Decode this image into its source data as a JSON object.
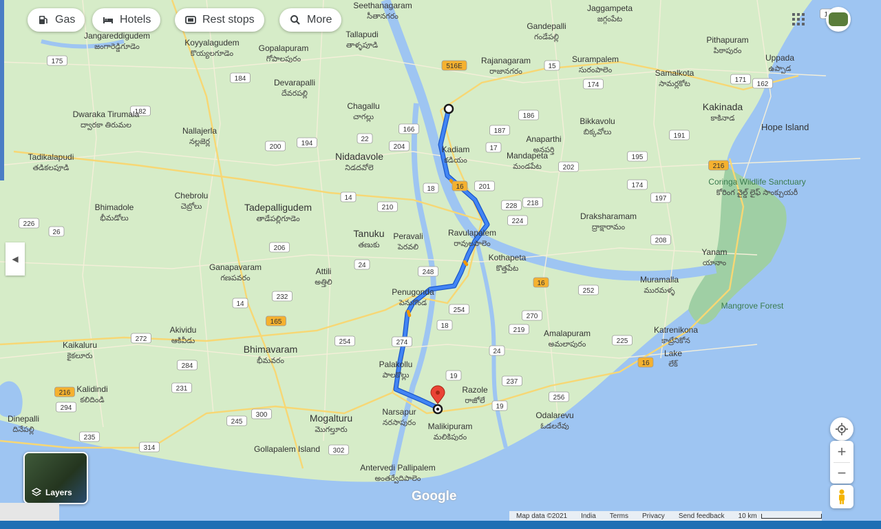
{
  "toolbar": {
    "gas": "Gas",
    "hotels": "Hotels",
    "rest_stops": "Rest stops",
    "more": "More"
  },
  "layers_label": "Layers",
  "footer": {
    "map_data": "Map data ©2021",
    "india": "India",
    "terms": "Terms",
    "privacy": "Privacy",
    "feedback": "Send feedback",
    "scale": "10 km"
  },
  "google_logo": "Google",
  "colors": {
    "land": "#d6ecc8",
    "water": "#9ec5f2",
    "route": "#4285f4",
    "route_outline": "#1a57c9",
    "highway_shield": "#f5b12f",
    "road": "#f7d774",
    "pin": "#ea4335"
  },
  "places": [
    {
      "name": "Seethanagaram",
      "native": "సీతానగరం"
    },
    {
      "name": "Jaggampeta",
      "native": "జగ్గంపేట"
    },
    {
      "name": "Gandepalli",
      "native": "గండేపల్లి"
    },
    {
      "name": "Pithapuram",
      "native": "పిఠాపురం"
    },
    {
      "name": "Tallapudi",
      "native": "తాళ్ళపూడి"
    },
    {
      "name": "Jangareddigudem",
      "native": "జంగారెడ్డిగూడెం"
    },
    {
      "name": "Koyyalagudem",
      "native": "కొయ్యలగూడెం"
    },
    {
      "name": "Gopalapuram",
      "native": "గోపాలపురం"
    },
    {
      "name": "Rajanagaram",
      "native": "రాజానగరం"
    },
    {
      "name": "Surampalem",
      "native": "సురంపాలెం"
    },
    {
      "name": "Samalkota",
      "native": "సామర్లకోట"
    },
    {
      "name": "Uppada",
      "native": "ఉప్పాడ"
    },
    {
      "name": "Devarapalli",
      "native": "దేవరపల్లి"
    },
    {
      "name": "Chagallu",
      "native": "చాగల్లు"
    },
    {
      "name": "Kakinada",
      "native": "కాకినాడ"
    },
    {
      "name": "Hope Island",
      "native": ""
    },
    {
      "name": "Dwaraka Tirumala",
      "native": "ద్వారకా తిరుమల"
    },
    {
      "name": "Nallajerla",
      "native": "నల్లజెర్ల"
    },
    {
      "name": "Bikkavolu",
      "native": "బిక్కవోలు"
    },
    {
      "name": "Anaparthi",
      "native": "అనపర్తి"
    },
    {
      "name": "Tadikalapudi",
      "native": "తడికలపూడి"
    },
    {
      "name": "Nidadavole",
      "native": "నిడదవోలె"
    },
    {
      "name": "Kadiam",
      "native": "కడియం"
    },
    {
      "name": "Mandapeta",
      "native": "మండపేట"
    },
    {
      "name": "Coringa Wildlife Sanctuary",
      "native": "కోరింగ వైల్డ్ లైఫ్ సాంక్చుయరీ"
    },
    {
      "name": "Chebrolu",
      "native": "చెబ్రోలు"
    },
    {
      "name": "Bhimadole",
      "native": "భీమడోలు"
    },
    {
      "name": "Tadepalligudem",
      "native": "తాడేపల్లిగూడెం"
    },
    {
      "name": "Draksharamam",
      "native": "ద్రాక్షారామం"
    },
    {
      "name": "Tanuku",
      "native": "తణుకు"
    },
    {
      "name": "Peravali",
      "native": "పెరవలి"
    },
    {
      "name": "Ravulapalem",
      "native": "రావులపాలెం"
    },
    {
      "name": "Kothapeta",
      "native": "కొత్తపేట"
    },
    {
      "name": "Yanam",
      "native": "యానాం"
    },
    {
      "name": "Ganapavaram",
      "native": "గణపవరం"
    },
    {
      "name": "Attili",
      "native": "అత్తిలి"
    },
    {
      "name": "Muramalla",
      "native": "మురమళ్ళ"
    },
    {
      "name": "Penugonda",
      "native": "పెనుగొండ"
    },
    {
      "name": "Mangrove Forest",
      "native": ""
    },
    {
      "name": "Akividu",
      "native": "ఆకివీడు"
    },
    {
      "name": "Kaikaluru",
      "native": "కైకలూరు"
    },
    {
      "name": "Bhimavaram",
      "native": "భీమవరం"
    },
    {
      "name": "Amalapuram",
      "native": "అమలాపురం"
    },
    {
      "name": "Katrenikona",
      "native": "కాట్రేనికోన"
    },
    {
      "name": "Lake",
      "native": "లేక్"
    },
    {
      "name": "Kalidindi",
      "native": "కలిదిండి"
    },
    {
      "name": "Palakollu",
      "native": "పాలకొల్లు"
    },
    {
      "name": "Razole",
      "native": "రాజోలే"
    },
    {
      "name": "Narsapur",
      "native": "నరసాపురం"
    },
    {
      "name": "Odalarevu",
      "native": "ఓడలరేవు"
    },
    {
      "name": "Mogalturu",
      "native": "మొగల్తూరు"
    },
    {
      "name": "Malikipuram",
      "native": "మలికిపురం"
    },
    {
      "name": "Gollapalem Island",
      "native": ""
    },
    {
      "name": "Antervedi Pallipalem",
      "native": "అంతర్వేదిపాలెం"
    },
    {
      "name": "Dinepalli",
      "native": "దినేపల్లి"
    }
  ],
  "shields": [
    "516E",
    "15",
    "174",
    "171",
    "162",
    "163",
    "175",
    "184",
    "186",
    "187",
    "17",
    "191",
    "182",
    "200",
    "194",
    "166",
    "22",
    "204",
    "202",
    "195",
    "216",
    "18",
    "16",
    "201",
    "174",
    "197",
    "14",
    "210",
    "228",
    "218",
    "226",
    "26",
    "224",
    "208",
    "206",
    "24",
    "248",
    "16",
    "252",
    "14",
    "232",
    "254",
    "270",
    "18",
    "219",
    "225",
    "272",
    "165",
    "254",
    "274",
    "24",
    "16",
    "284",
    "19",
    "237",
    "216",
    "231",
    "256",
    "294",
    "19",
    "235",
    "245",
    "300",
    "302",
    "314",
    "216"
  ]
}
